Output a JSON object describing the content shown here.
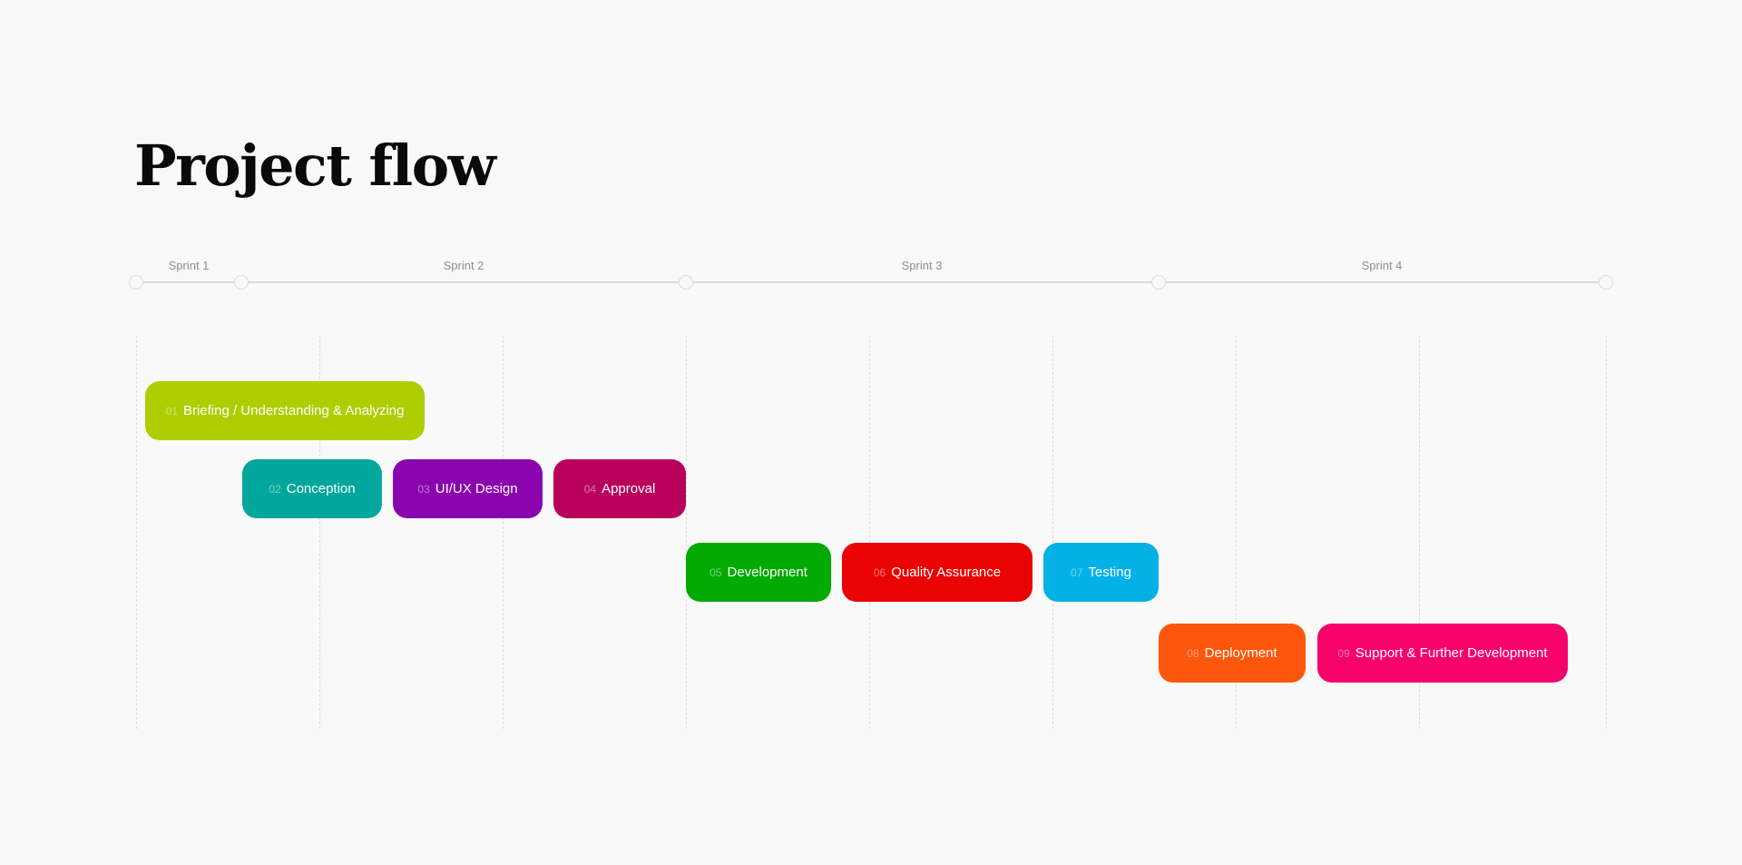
{
  "page": {
    "title": "Project flow"
  },
  "timeline": {
    "sprints": [
      {
        "label": "Sprint 1"
      },
      {
        "label": "Sprint 2"
      },
      {
        "label": "Sprint 3"
      },
      {
        "label": "Sprint 4"
      }
    ]
  },
  "phases": [
    {
      "number": "01",
      "label": "Briefing / Understanding & Analyzing",
      "color": "#aece02",
      "sprint": "Sprint 1"
    },
    {
      "number": "02",
      "label": "Conception",
      "color": "#01a79c",
      "sprint": "Sprint 2"
    },
    {
      "number": "03",
      "label": "UI/UX Design",
      "color": "#8a04ae",
      "sprint": "Sprint 2"
    },
    {
      "number": "04",
      "label": "Approval",
      "color": "#b7015b",
      "sprint": "Sprint 2"
    },
    {
      "number": "05",
      "label": "Development",
      "color": "#03aa03",
      "sprint": "Sprint 3"
    },
    {
      "number": "06",
      "label": "Quality Assurance",
      "color": "#e90303",
      "sprint": "Sprint 3"
    },
    {
      "number": "07",
      "label": "Testing",
      "color": "#03b1e6",
      "sprint": "Sprint 3"
    },
    {
      "number": "08",
      "label": "Deployment",
      "color": "#fe560c",
      "sprint": "Sprint 4"
    },
    {
      "number": "09",
      "label": "Support & Further Development",
      "color": "#f6026b",
      "sprint": "Sprint 4"
    }
  ]
}
